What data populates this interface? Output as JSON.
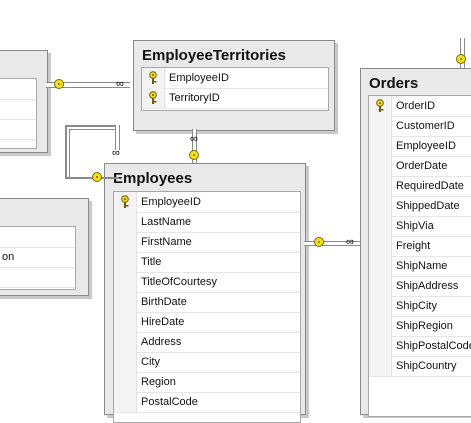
{
  "tables": {
    "employee_territories": {
      "title": "EmployeeTerritories",
      "columns": [
        {
          "name": "EmployeeID",
          "key": true
        },
        {
          "name": "TerritoryID",
          "key": true
        }
      ]
    },
    "orders": {
      "title": "Orders",
      "columns": [
        {
          "name": "OrderID",
          "key": true
        },
        {
          "name": "CustomerID",
          "key": false
        },
        {
          "name": "EmployeeID",
          "key": false
        },
        {
          "name": "OrderDate",
          "key": false
        },
        {
          "name": "RequiredDate",
          "key": false
        },
        {
          "name": "ShippedDate",
          "key": false
        },
        {
          "name": "ShipVia",
          "key": false
        },
        {
          "name": "Freight",
          "key": false
        },
        {
          "name": "ShipName",
          "key": false
        },
        {
          "name": "ShipAddress",
          "key": false
        },
        {
          "name": "ShipCity",
          "key": false
        },
        {
          "name": "ShipRegion",
          "key": false
        },
        {
          "name": "ShipPostalCode",
          "key": false
        },
        {
          "name": "ShipCountry",
          "key": false
        }
      ]
    },
    "employees": {
      "title": "Employees",
      "columns": [
        {
          "name": "EmployeeID",
          "key": true
        },
        {
          "name": "LastName",
          "key": false
        },
        {
          "name": "FirstName",
          "key": false
        },
        {
          "name": "Title",
          "key": false
        },
        {
          "name": "TitleOfCourtesy",
          "key": false
        },
        {
          "name": "BirthDate",
          "key": false
        },
        {
          "name": "HireDate",
          "key": false
        },
        {
          "name": "Address",
          "key": false
        },
        {
          "name": "City",
          "key": false
        },
        {
          "name": "Region",
          "key": false
        },
        {
          "name": "PostalCode",
          "key": false
        }
      ]
    },
    "left_table_lower": {
      "visible_text": "on"
    }
  },
  "colors": {
    "key_gold": "#f3e020",
    "line_grey": "#8a8a8a"
  }
}
